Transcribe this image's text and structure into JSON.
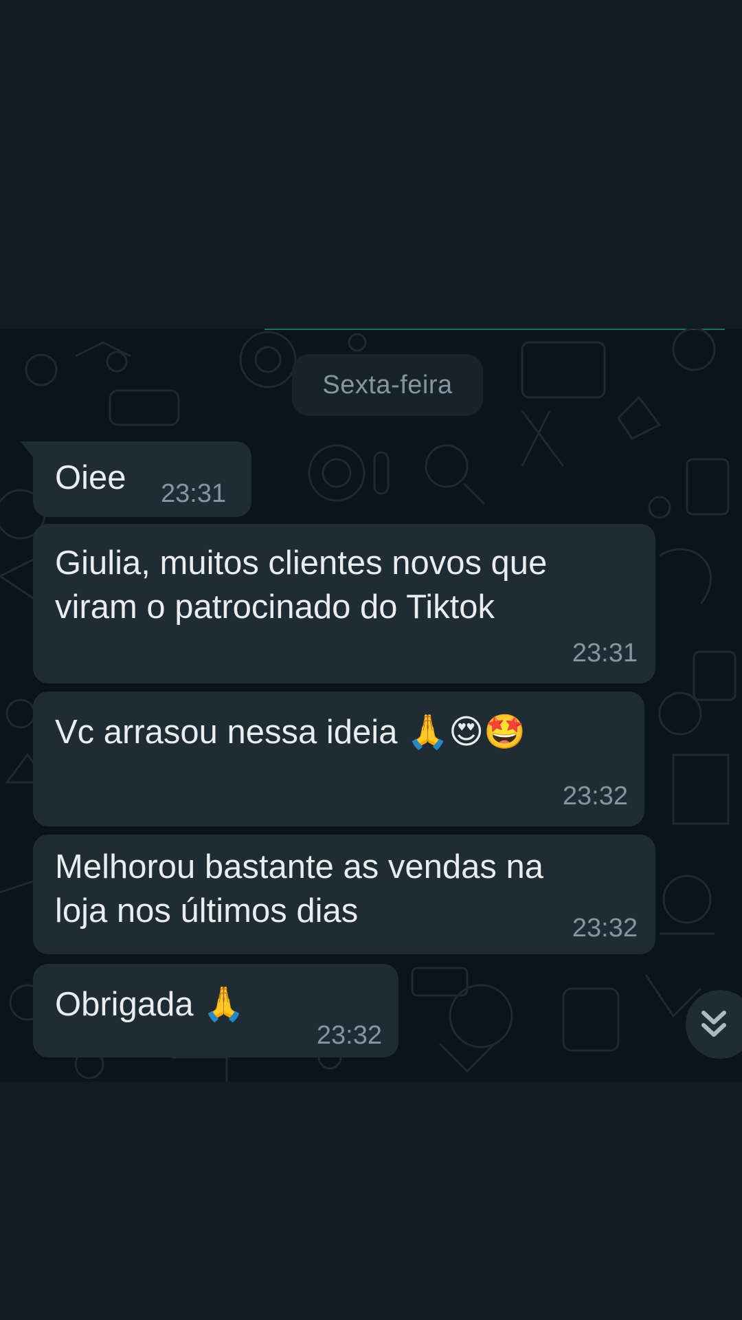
{
  "chat": {
    "date_separator": "Sexta-feira",
    "messages": [
      {
        "text_lines": [
          "Oiee"
        ],
        "time": "23:31"
      },
      {
        "text_lines": [
          "Giulia, muitos clientes novos que",
          "viram o patrocinado do Tiktok"
        ],
        "time": "23:31"
      },
      {
        "text_lines": [
          "Vc arrasou nessa ideia 🙏😍🤩"
        ],
        "time": "23:32"
      },
      {
        "text_lines": [
          "Melhorou bastante as vendas na",
          "loja nos últimos dias"
        ],
        "time": "23:32"
      },
      {
        "text_lines": [
          "Obrigada 🙏"
        ],
        "time": "23:32"
      }
    ]
  },
  "icons": {
    "scroll_down": "double-chevron-down-icon",
    "wallpaper": "doodle-pattern"
  },
  "colors": {
    "screen_background": "#111b21",
    "chat_background": "#0b141a",
    "incoming_bubble": "#202c33",
    "message_text": "#e9edef",
    "timestamp_text": "#8696a0",
    "accent_line": "#1f6f5c"
  }
}
